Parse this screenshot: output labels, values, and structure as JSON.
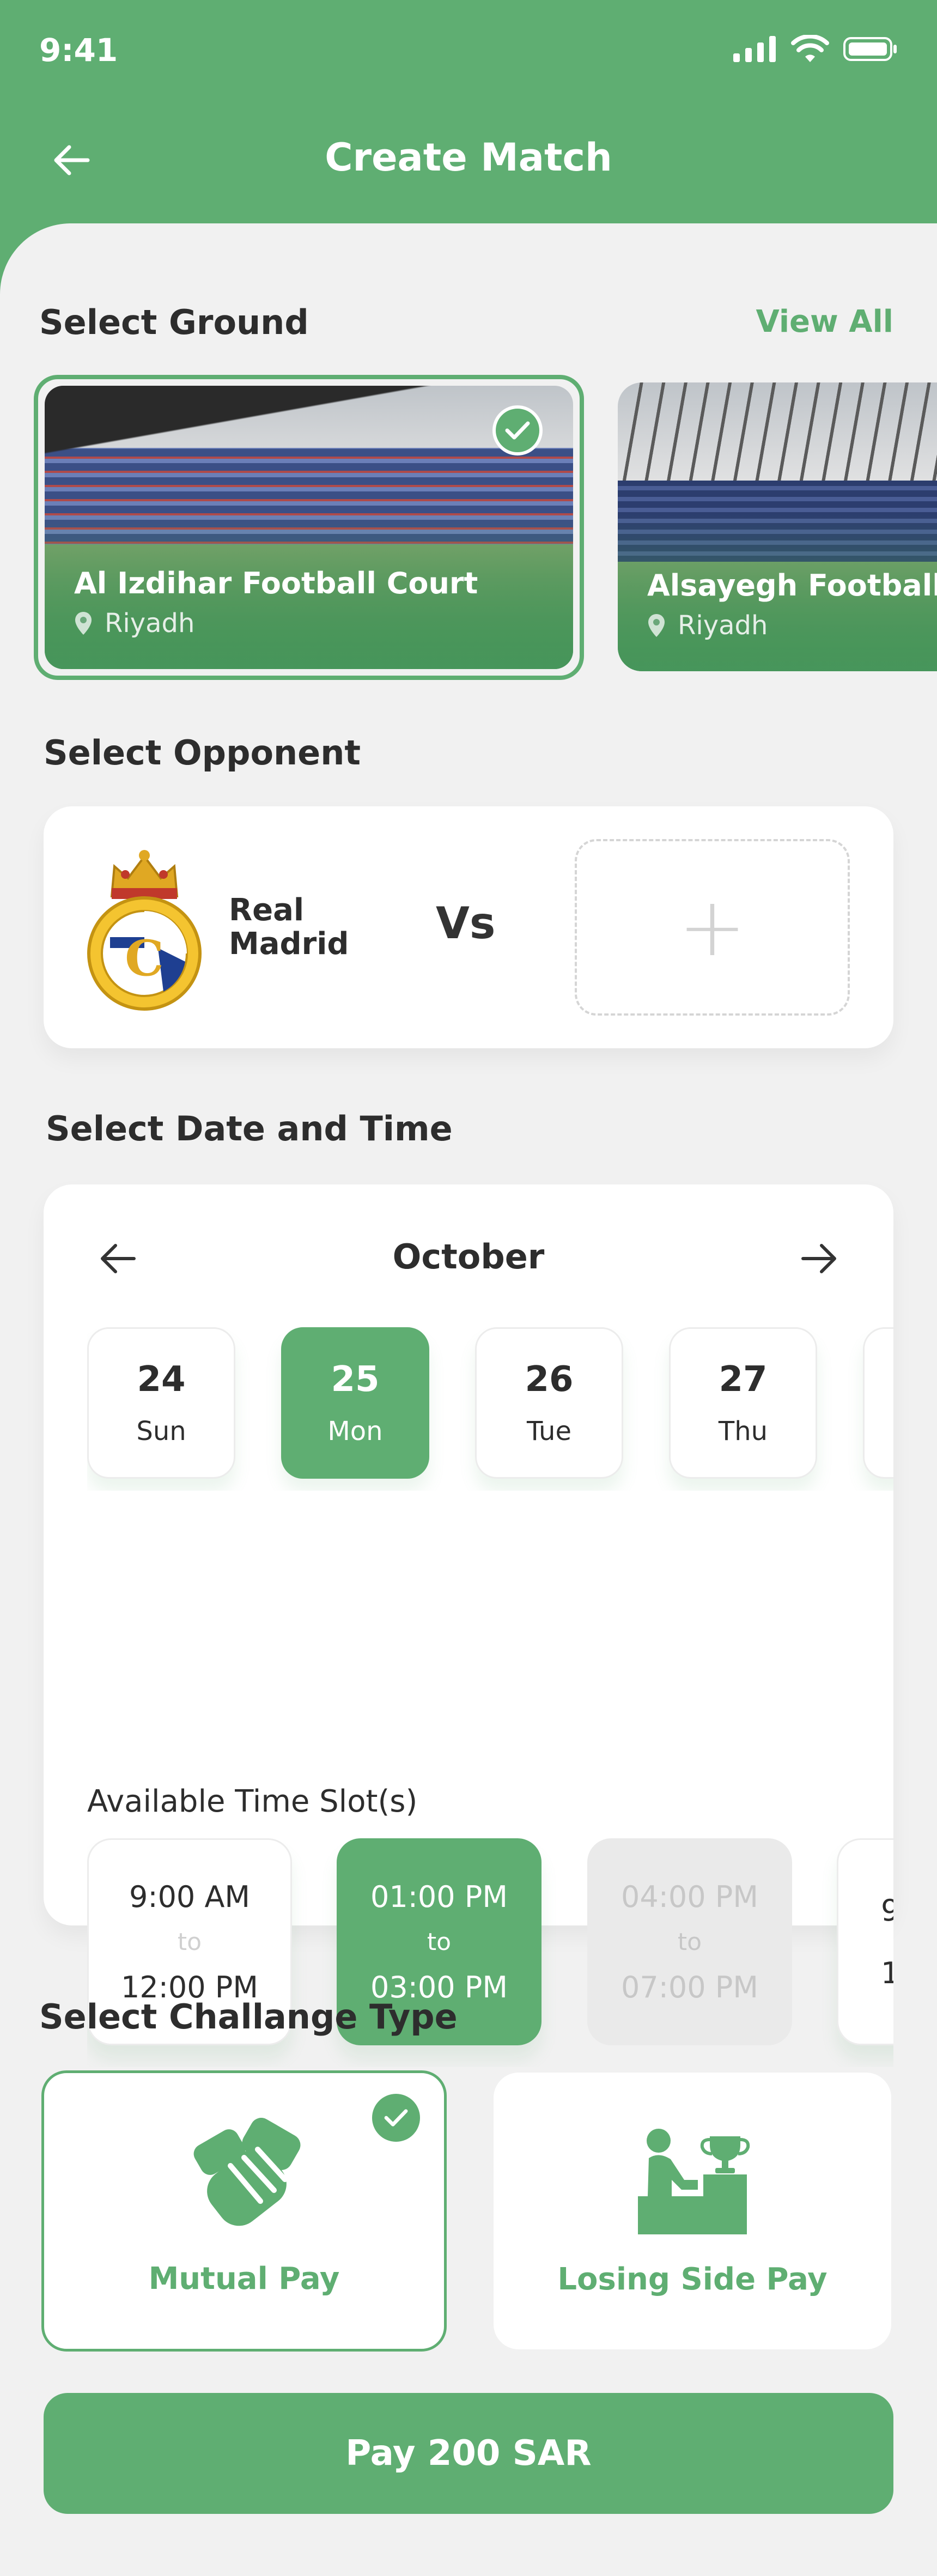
{
  "status_bar": {
    "time": "9:41"
  },
  "header": {
    "title": "Create Match"
  },
  "ground": {
    "section_title": "Select Ground",
    "view_all": "View All",
    "items": [
      {
        "name": "Al Izdihar Football Court",
        "location": "Riyadh",
        "selected": true
      },
      {
        "name": "Alsayegh Football Court",
        "location": "Riyadh",
        "selected": false
      }
    ]
  },
  "opponent": {
    "section_title": "Select Opponent",
    "team_name": "Real Madrid",
    "vs": "Vs",
    "add_symbol": "+"
  },
  "datetime": {
    "section_title": "Select Date and Time",
    "month": "October",
    "days": [
      {
        "num": "24",
        "weekday": "Sun"
      },
      {
        "num": "25",
        "weekday": "Mon"
      },
      {
        "num": "26",
        "weekday": "Tue"
      },
      {
        "num": "27",
        "weekday": "Thu"
      }
    ],
    "slots_title": "Available Time Slot(s)",
    "slots": [
      {
        "start": "9:00 AM",
        "sep": "to",
        "end": "12:00 PM",
        "state": "available"
      },
      {
        "start": "01:00 PM",
        "sep": "to",
        "end": "03:00 PM",
        "state": "selected"
      },
      {
        "start": "04:00 PM",
        "sep": "to",
        "end": "07:00 PM",
        "state": "disabled"
      },
      {
        "start": "9",
        "sep": "",
        "end": "1",
        "state": "available"
      }
    ]
  },
  "challenge": {
    "section_title": "Select Challange Type",
    "options": [
      {
        "label": "Mutual Pay",
        "icon": "handshake-icon",
        "selected": true
      },
      {
        "label": "Losing Side Pay",
        "icon": "podium-trophy-icon",
        "selected": false
      }
    ]
  },
  "pay_button": {
    "label": "Pay 200 SAR"
  },
  "colors": {
    "accent": "#5fae72",
    "background": "#f1f1f1",
    "card": "#ffffff"
  }
}
